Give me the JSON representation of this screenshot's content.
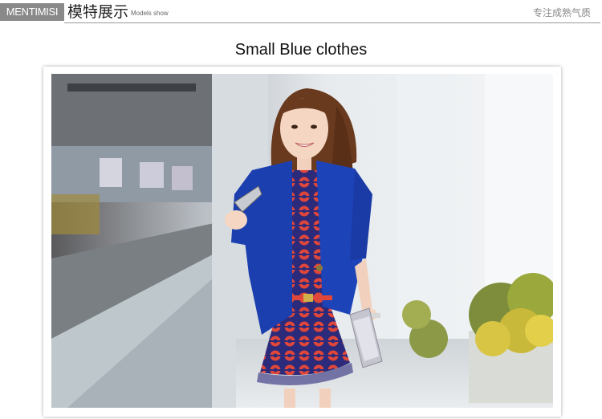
{
  "header": {
    "brand": "MENTIMISI",
    "title_cn": "模特展示",
    "title_en": "Models show",
    "slogan": "专注成熟气质"
  },
  "section": {
    "heading": "Small Blue clothes"
  },
  "photo": {
    "subject": "model-photo",
    "colors": {
      "jacket": "#1c3fb0",
      "dress_base": "#2c2a7a",
      "dress_pattern": "#e0473a",
      "hair": "#6a3a1e",
      "background": "#dfe4e8"
    }
  }
}
